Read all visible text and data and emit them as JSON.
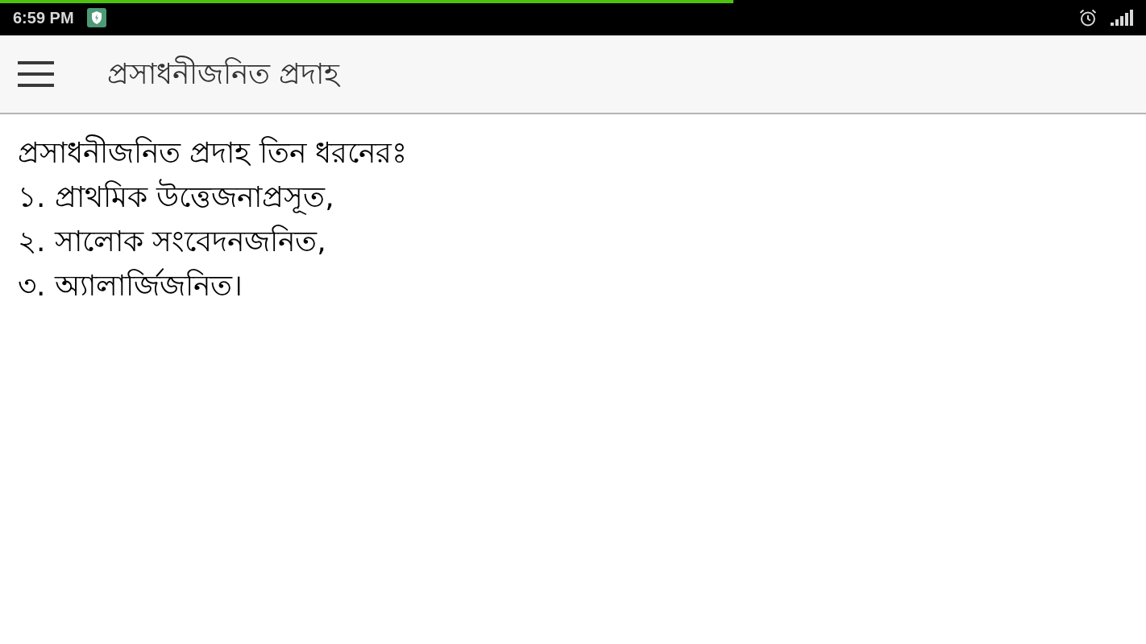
{
  "status_bar": {
    "time": "6:59 PM",
    "progress": {
      "level": 0.64
    }
  },
  "app_bar": {
    "title": "প্রসাধনীজনিত প্রদাহ"
  },
  "content": {
    "lines": [
      "প্রসাধনীজনিত প্রদাহ তিন ধরনেরঃ",
      "১. প্রাথমিক উত্তেজনাপ্রসূত,",
      "২. সালোক সংবেদনজনিত,",
      "৩. অ্যালার্জিজনিত।"
    ]
  }
}
